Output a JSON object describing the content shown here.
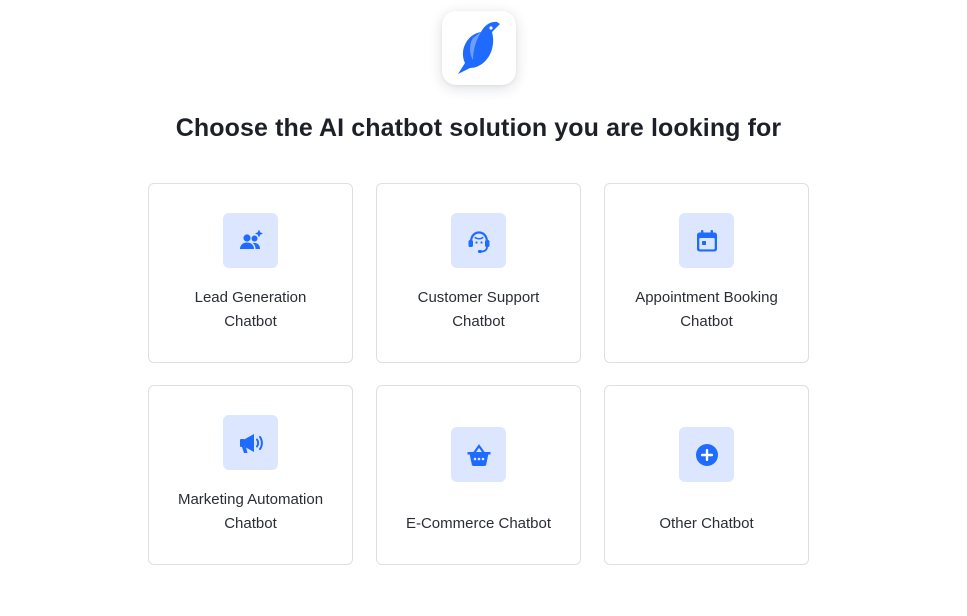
{
  "header": {
    "logo_icon": "bird-logo-icon",
    "title": "Choose the AI chatbot solution you are looking for"
  },
  "colors": {
    "accent": "#1f6bff",
    "icon_tile_bg": "#dde6ff",
    "card_border": "#dcdfe5",
    "text": "#1d2127"
  },
  "options": [
    {
      "line1": "Lead Generation",
      "line2": "Chatbot",
      "icon": "users-sparkle-icon"
    },
    {
      "line1": "Customer Support",
      "line2": "Chatbot",
      "icon": "headset-agent-icon"
    },
    {
      "line1": "Appointment Booking",
      "line2": "Chatbot",
      "icon": "calendar-icon"
    },
    {
      "line1": "Marketing Automation",
      "line2": "Chatbot",
      "icon": "megaphone-icon"
    },
    {
      "line1": "E-Commerce Chatbot",
      "line2": "",
      "icon": "shopping-basket-icon"
    },
    {
      "line1": "Other Chatbot",
      "line2": "",
      "icon": "plus-circle-icon"
    }
  ]
}
